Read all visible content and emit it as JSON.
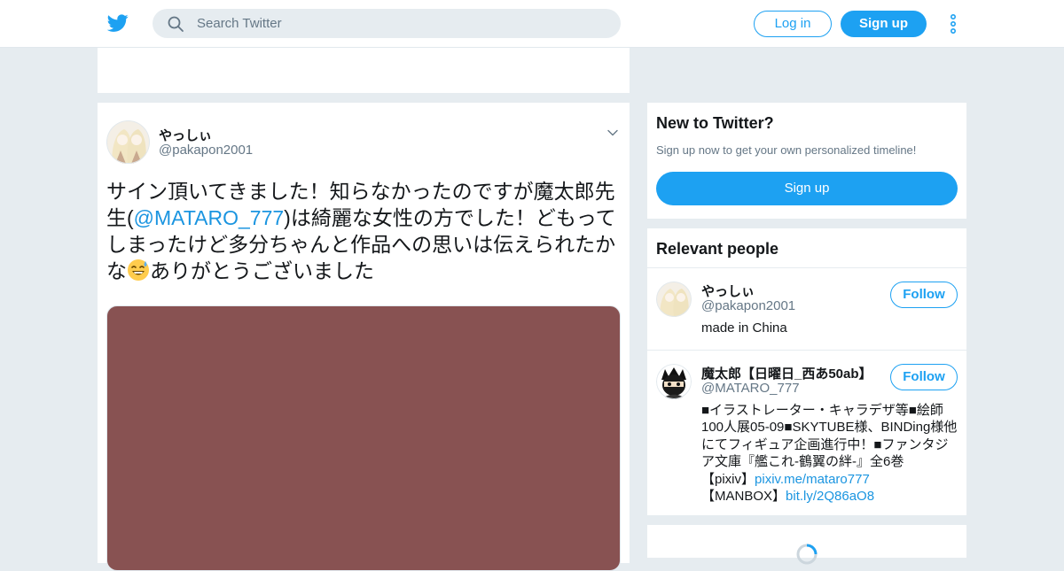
{
  "colors": {
    "brand": "#1da1f2",
    "link": "#1b95e0",
    "background": "#e6ecf0",
    "media": "#885252"
  },
  "header": {
    "logo_icon": "twitter-bird-icon",
    "search": {
      "placeholder": "Search Twitter",
      "icon": "search-icon"
    },
    "login_label": "Log in",
    "signup_label": "Sign up",
    "more_icon": "more-vertical-icon"
  },
  "tweet": {
    "author_name": "やっしぃ",
    "author_handle": "@pakapon2001",
    "text_part1": "サイン頂いてきました！知らなかったのですが魔太郎先生(",
    "mention": "@MATARO_777",
    "text_part2": ")は綺麗な女性の方でした！どもってしまったけど多分ちゃんと作品への思いは伝えられたかな",
    "emoji": "grinning-sweat-emoji",
    "text_part3": "ありがとうございました",
    "caret_icon": "chevron-down-icon"
  },
  "new_to_twitter": {
    "title": "New to Twitter?",
    "subtitle": "Sign up now to get your own personalized timeline!",
    "button_label": "Sign up"
  },
  "relevant_people": {
    "title": "Relevant people",
    "people": [
      {
        "name": "やっしぃ",
        "handle": "@pakapon2001",
        "follow_label": "Follow",
        "bio": "made in China"
      },
      {
        "name": "魔太郎【日曜日_西あ50ab】",
        "handle": "@MATARO_777",
        "follow_label": "Follow",
        "bio_text": "■イラストレーター・キャラデザ等■絵師100人展05-09■SKYTUBE様、BINDing様他にてフィギュア企画進行中！■ファンタジア文庫『艦これ-鶴翼の絆-』全6巻",
        "bio_pixiv_label": "【pixiv】",
        "bio_pixiv_link": "pixiv.me/mataro777",
        "bio_manbox_label": "【MANBOX】",
        "bio_manbox_link": "bit.ly/2Q86aO8"
      }
    ]
  }
}
